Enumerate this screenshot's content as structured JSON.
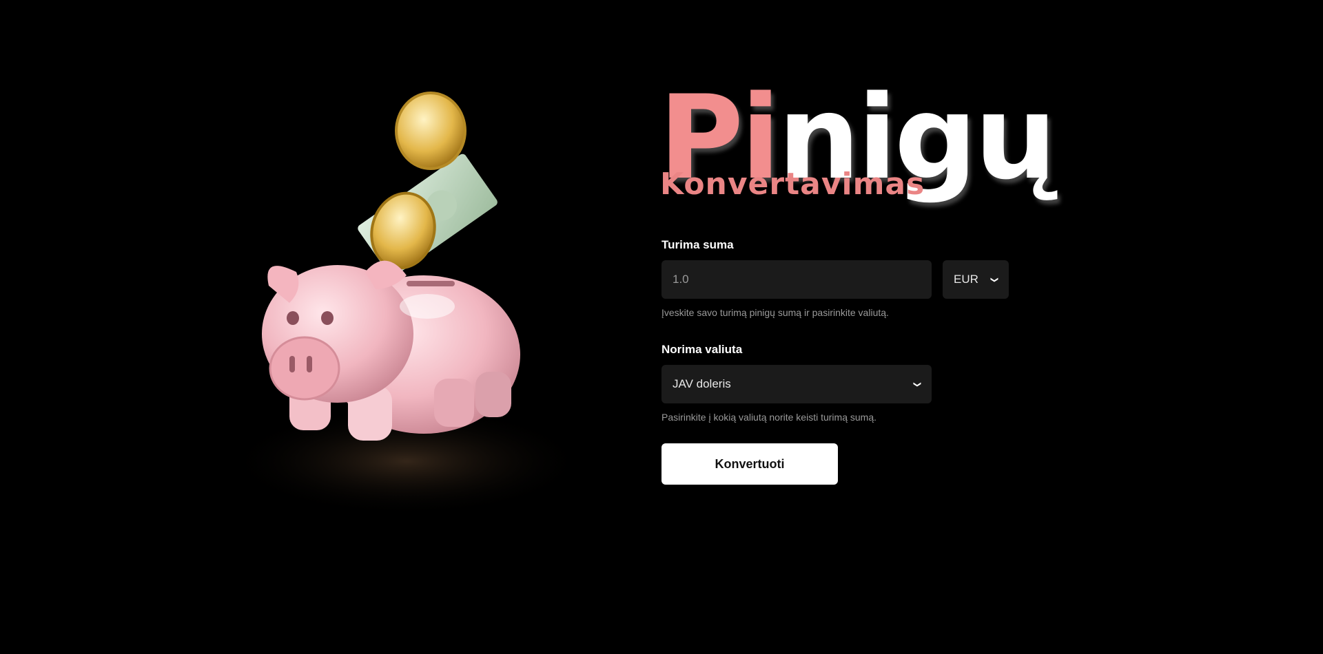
{
  "title": {
    "highlight": "Pi",
    "rest": "nigų",
    "subtitle": "Konvertavimas"
  },
  "form": {
    "amount_label": "Turima suma",
    "amount_value": "1.0",
    "currency_selected": "EUR",
    "amount_help": "Įveskite savo turimą pinigų sumą ir pasirinkite valiutą.",
    "target_label": "Norima valiuta",
    "target_selected": "JAV doleris",
    "target_help": "Pasirinkite į kokią valiutą norite keisti turimą sumą.",
    "submit_label": "Konvertuoti"
  },
  "colors": {
    "accent": "#f28e8e",
    "background": "#000000",
    "field": "#1b1b1b"
  },
  "icons": [
    "piggy-bank-illustration",
    "chevron-down-icon"
  ]
}
